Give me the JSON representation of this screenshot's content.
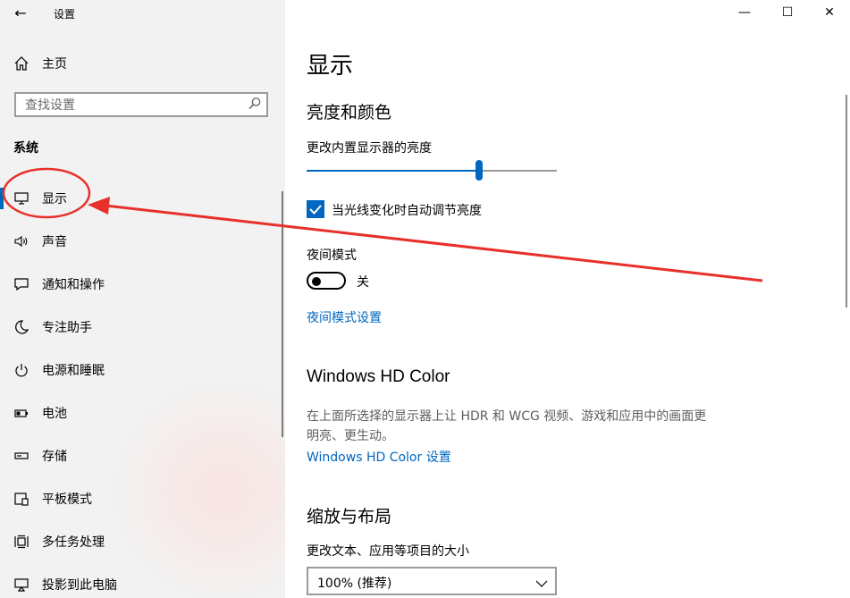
{
  "window": {
    "title": "设置",
    "back_icon": "back-arrow-icon",
    "controls": {
      "minimize": "—",
      "maximize": "☐",
      "close": "✕"
    }
  },
  "sidebar": {
    "home": {
      "icon": "home-icon",
      "label": "主页"
    },
    "search": {
      "placeholder": "查找设置",
      "value": "",
      "icon": "search-icon"
    },
    "section_title": "系统",
    "items": [
      {
        "icon": "monitor-icon",
        "label": "显示",
        "active": true
      },
      {
        "icon": "speaker-icon",
        "label": "声音"
      },
      {
        "icon": "notification-icon",
        "label": "通知和操作"
      },
      {
        "icon": "moon-icon",
        "label": "专注助手"
      },
      {
        "icon": "power-icon",
        "label": "电源和睡眠"
      },
      {
        "icon": "battery-icon",
        "label": "电池"
      },
      {
        "icon": "storage-icon",
        "label": "存储"
      },
      {
        "icon": "tablet-icon",
        "label": "平板模式"
      },
      {
        "icon": "multitask-icon",
        "label": "多任务处理"
      },
      {
        "icon": "project-icon",
        "label": "投影到此电脑"
      }
    ]
  },
  "main": {
    "title": "显示",
    "brightness_section": {
      "heading": "亮度和颜色",
      "slider_label": "更改内置显示器的亮度",
      "brightness_fraction": 0.69,
      "auto_checkbox_label": "当光线变化时自动调节亮度",
      "auto_checked": true,
      "night_mode_label": "夜间模式",
      "night_mode_state": "关",
      "night_mode_on": false,
      "night_mode_link": "夜间模式设置"
    },
    "hd_color_section": {
      "heading": "Windows HD Color",
      "description": "在上面所选择的显示器上让 HDR 和 WCG 视频、游戏和应用中的画面更明亮、更生动。",
      "link": "Windows HD Color 设置"
    },
    "layout_section": {
      "heading": "缩放与布局",
      "scale_label": "更改文本、应用等项目的大小",
      "scale_value": "100% (推荐)"
    }
  },
  "annotation": {
    "color": "#e8302a"
  },
  "colors": {
    "accent": "#0067c0",
    "sidebar_bg": "#f2f2f2"
  }
}
